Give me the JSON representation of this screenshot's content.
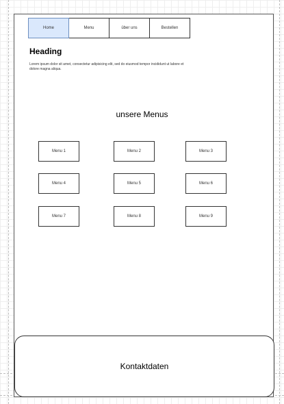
{
  "nav": {
    "tabs": [
      {
        "label": "Home",
        "active": true
      },
      {
        "label": "Menu",
        "active": false
      },
      {
        "label": "über uns",
        "active": false
      },
      {
        "label": "Bestellen",
        "active": false
      }
    ]
  },
  "content": {
    "heading": "Heading",
    "body": "Lorem ipsum dolor sit amet, consectetur adipisicing elit, sed do eiusmod tempor incididunt ut labore et dolore magna aliqua."
  },
  "menus": {
    "title": "unsere Menus",
    "items": [
      "Menu 1",
      "Menu 2",
      "Menu 3",
      "Menu 4",
      "Menu 5",
      "Menu 6",
      "Menu 7",
      "Menu 8",
      "Menu 9"
    ]
  },
  "footer": {
    "contact": "Kontaktdaten"
  },
  "colors": {
    "active_tab_fill": "#dae8fc",
    "active_tab_border": "#6c8ebf"
  }
}
